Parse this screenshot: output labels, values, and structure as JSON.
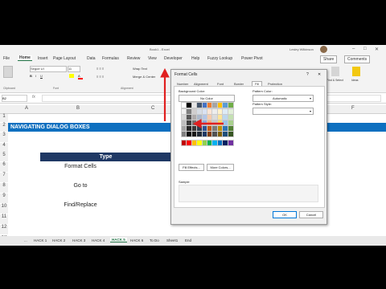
{
  "window": {
    "title": "Book1 - Excel",
    "user": "Lesley Wilkinson"
  },
  "menu": {
    "items": [
      "File",
      "Home",
      "Insert",
      "Page Layout",
      "Data",
      "Formulas",
      "Review",
      "View",
      "Developer",
      "Help",
      "Fuzzy Lookup",
      "Power Pivot"
    ],
    "active": "Home",
    "share": "Share",
    "comments": "Comments"
  },
  "ribbon": {
    "font_name": "Segoe UI",
    "font_size": "11",
    "wrap_text": "Wrap Text",
    "merge_center": "Merge & Center",
    "groups": [
      "Clipboard",
      "Font",
      "Alignment"
    ],
    "right_buttons": [
      "Find & Select",
      "Ideas"
    ]
  },
  "formula_bar": {
    "name_box": "B2",
    "fx": "fx"
  },
  "columns": [
    "A",
    "B",
    "C",
    "D",
    "E",
    "F"
  ],
  "rows": [
    "1",
    "2",
    "3",
    "4",
    "5",
    "6",
    "7",
    "8",
    "9",
    "10",
    "11",
    "12",
    "13"
  ],
  "sheet": {
    "banner": "NAVIGATING DIALOG BOXES",
    "table_header": "Type",
    "items": [
      "Format Cells",
      "Go to",
      "Find/Replace"
    ]
  },
  "sheet_tabs": {
    "tabs": [
      "...",
      "HACK 1",
      "HACK 2",
      "HACK 3",
      "HACK 4",
      "HACK 5",
      "HACK 6",
      "To Do",
      "Sheet1",
      "End"
    ],
    "active": "HACK 5"
  },
  "dialog": {
    "title": "Format Cells",
    "help": "?",
    "close": "✕",
    "tabs": [
      "Number",
      "Alignment",
      "Font",
      "Border",
      "Fill",
      "Protection"
    ],
    "active_tab": "Fill",
    "background_color_label": "Background Color:",
    "no_color": "No Color",
    "pattern_color_label": "Pattern Color:",
    "pattern_color_value": "Automatic",
    "pattern_style_label": "Pattern Style:",
    "fill_effects": "Fill Effects...",
    "more_colors": "More Colors...",
    "sample_label": "Sample",
    "ok": "OK",
    "cancel": "Cancel"
  },
  "palette": {
    "theme_row": [
      "#ffffff",
      "#000000",
      "#e7e6e6",
      "#44546a",
      "#4472c4",
      "#ed7d31",
      "#a5a5a5",
      "#ffc000",
      "#5b9bd5",
      "#70ad47"
    ],
    "shade_rows": [
      [
        "#f2f2f2",
        "#7f7f7f",
        "#d0cece",
        "#d6dce4",
        "#d9e2f3",
        "#fbe5d5",
        "#ededed",
        "#fff2cc",
        "#deebf6",
        "#e2efd9"
      ],
      [
        "#d8d8d8",
        "#595959",
        "#aeabab",
        "#adb9ca",
        "#b4c6e7",
        "#f7cbac",
        "#dbdbdb",
        "#fee599",
        "#bdd7ee",
        "#c5e0b3"
      ],
      [
        "#bfbfbf",
        "#3f3f3f",
        "#757070",
        "#8496b0",
        "#8eaadb",
        "#f4b183",
        "#c9c9c9",
        "#ffd966",
        "#9cc3e5",
        "#a8d08d"
      ],
      [
        "#a5a5a5",
        "#262626",
        "#3a3838",
        "#323f4f",
        "#2f5496",
        "#c55a11",
        "#7b7b7b",
        "#bf9000",
        "#2e75b5",
        "#538135"
      ],
      [
        "#7f7f7f",
        "#0c0c0c",
        "#171616",
        "#222a35",
        "#1f3864",
        "#833c0b",
        "#525252",
        "#7f6000",
        "#1e4e79",
        "#375623"
      ]
    ],
    "standard_row": [
      "#c00000",
      "#ff0000",
      "#ffc000",
      "#ffff00",
      "#92d050",
      "#00b050",
      "#00b0f0",
      "#0070c0",
      "#002060",
      "#7030a0"
    ],
    "arrow_color": "#e02020"
  }
}
